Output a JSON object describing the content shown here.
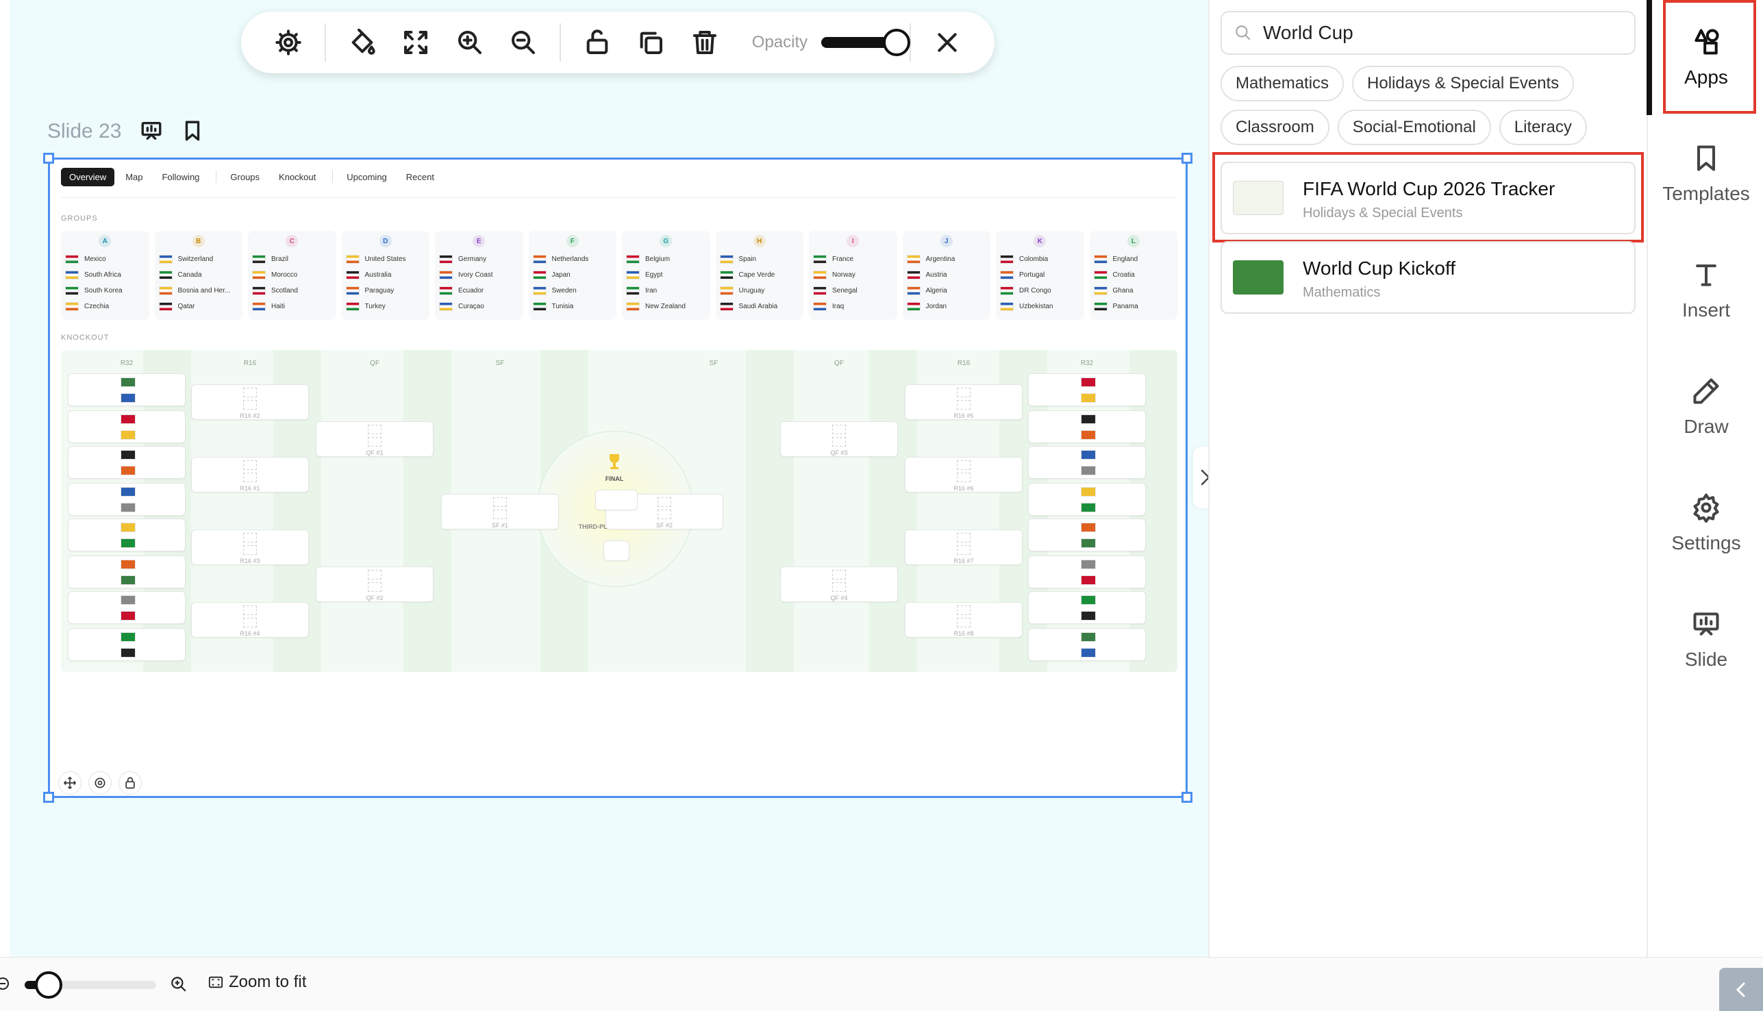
{
  "toolbar": {
    "buttons": [
      "settings-icon",
      "paint-bucket-icon",
      "fullscreen-icon",
      "zoom-in-icon",
      "zoom-out-icon",
      "unlock-icon",
      "duplicate-icon",
      "trash-icon"
    ],
    "opacity_label": "Opacity",
    "opacity_value": 1.0
  },
  "slide": {
    "label": "Slide 23"
  },
  "tracker": {
    "tabs": [
      {
        "label": "Overview"
      },
      {
        "label": "Map"
      },
      {
        "label": "Following"
      },
      {
        "label": "Groups"
      },
      {
        "label": "Knockout"
      },
      {
        "label": "Upcoming"
      },
      {
        "label": "Recent"
      }
    ],
    "groups_title": "GROUPS",
    "knockout_title": "KNOCKOUT",
    "groups": [
      {
        "letter": "A",
        "color": "#1a8fb0",
        "teams": [
          "Mexico",
          "South Africa",
          "South Korea",
          "Czechia"
        ]
      },
      {
        "letter": "B",
        "color": "#c98a00",
        "teams": [
          "Switzerland",
          "Canada",
          "Bosnia and Her...",
          "Qatar"
        ]
      },
      {
        "letter": "C",
        "color": "#d14a8a",
        "teams": [
          "Brazil",
          "Morocco",
          "Scotland",
          "Haiti"
        ]
      },
      {
        "letter": "D",
        "color": "#2d6fd1",
        "teams": [
          "United States",
          "Australia",
          "Paraguay",
          "Turkey"
        ]
      },
      {
        "letter": "E",
        "color": "#8a44c9",
        "teams": [
          "Germany",
          "Ivory Coast",
          "Ecuador",
          "Curaçao"
        ]
      },
      {
        "letter": "F",
        "color": "#2aa35a",
        "teams": [
          "Netherlands",
          "Japan",
          "Sweden",
          "Tunisia"
        ]
      },
      {
        "letter": "G",
        "color": "#1aa0a0",
        "teams": [
          "Belgium",
          "Egypt",
          "Iran",
          "New Zealand"
        ]
      },
      {
        "letter": "H",
        "color": "#c98a00",
        "teams": [
          "Spain",
          "Cape Verde",
          "Uruguay",
          "Saudi Arabia"
        ]
      },
      {
        "letter": "I",
        "color": "#d14a8a",
        "teams": [
          "France",
          "Norway",
          "Senegal",
          "Iraq"
        ]
      },
      {
        "letter": "J",
        "color": "#2d6fd1",
        "teams": [
          "Argentina",
          "Austria",
          "Algeria",
          "Jordan"
        ]
      },
      {
        "letter": "K",
        "color": "#8a44c9",
        "teams": [
          "Colombia",
          "Portugal",
          "DR Congo",
          "Uzbekistan"
        ]
      },
      {
        "letter": "L",
        "color": "#2aa35a",
        "teams": [
          "England",
          "Croatia",
          "Ghana",
          "Panama"
        ]
      }
    ],
    "rounds": [
      "R32",
      "R16",
      "QF",
      "SF",
      "SF",
      "QF",
      "R16",
      "R32"
    ],
    "matches": {
      "r16_left": [
        "R16 #2",
        "R16 #1",
        "R16 #3",
        "R16 #4"
      ],
      "qf_left": [
        "QF #1",
        "QF #2"
      ],
      "sf_left": "SF #1",
      "sf_right": "SF #2",
      "qf_right": [
        "QF #3",
        "QF #4"
      ],
      "r16_right": [
        "R16 #5",
        "R16 #6",
        "R16 #7",
        "R16 #8"
      ]
    },
    "final_label": "FINAL",
    "third_place_label": "THIRD-PLACE PLAYOFF"
  },
  "bottom": {
    "zoom_fit_label": "Zoom to fit",
    "zoom_value": 0.1
  },
  "panel": {
    "search": {
      "value": "World Cup",
      "placeholder": "Search"
    },
    "chips": [
      "Mathematics",
      "Holidays & Special Events",
      "Classroom",
      "Social-Emotional",
      "Literacy"
    ],
    "results": [
      {
        "title": "FIFA World Cup 2026 Tracker",
        "subtitle": "Holidays & Special Events"
      },
      {
        "title": "World Cup Kickoff",
        "subtitle": "Mathematics"
      }
    ]
  },
  "nav": {
    "items": [
      {
        "label": "Apps",
        "icon": "shapes-icon"
      },
      {
        "label": "Templates",
        "icon": "bookmark-icon"
      },
      {
        "label": "Insert",
        "icon": "text-icon"
      },
      {
        "label": "Draw",
        "icon": "pencil-icon"
      },
      {
        "label": "Settings",
        "icon": "gear-icon"
      },
      {
        "label": "Slide",
        "icon": "presentation-icon"
      }
    ]
  },
  "colors": {
    "accent": "#4a8ff0",
    "highlight": "#e03a2c",
    "canvas": "#effcfd"
  }
}
